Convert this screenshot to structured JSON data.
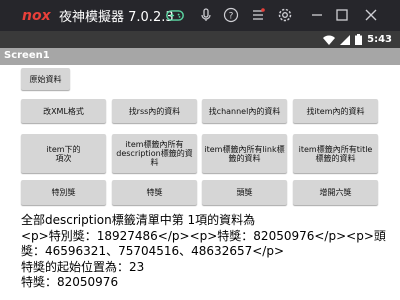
{
  "emulator": {
    "brand": "nox",
    "title": "夜神模擬器 7.0.2.3",
    "icons": [
      "gamepad-icon",
      "mic-icon",
      "help-icon",
      "menu-icon",
      "settings-icon",
      "minimize-icon",
      "maximize-icon",
      "close-icon"
    ]
  },
  "status_bar": {
    "time": "5:43",
    "icons": [
      "wifi-icon",
      "signal-icon",
      "battery-icon"
    ]
  },
  "app_bar": {
    "title": "Screen1"
  },
  "buttons": {
    "original_data": "原始資料",
    "row1": [
      "改XML格式",
      "找rss內的資料",
      "找channel內的資料",
      "找item內的資料"
    ],
    "row2": [
      "item下的項次",
      "item標籤內所有description標籤的資料",
      "item標籤內所有link標籤的資料",
      "item標籤內所有title標籤的資料"
    ],
    "row3": [
      "特別獎",
      "特獎",
      "頭獎",
      "增開六獎"
    ]
  },
  "result": {
    "line1": "全部description標籤清單中第 1項的資料為",
    "line2": "<p>特別獎：18927486</p><p>特獎：82050976</p><p>頭",
    "line3": "獎：46596321、75704516、48632657</p>",
    "line4": "特獎的起始位置為：23",
    "line5": "特獎：82050976"
  },
  "colors": {
    "nox_bar": "#26262b",
    "nox_logo": "#e8403a",
    "status_bar": "#3a3a3a",
    "app_bar": "#a6a6a6",
    "button": "#d6d6d6"
  }
}
